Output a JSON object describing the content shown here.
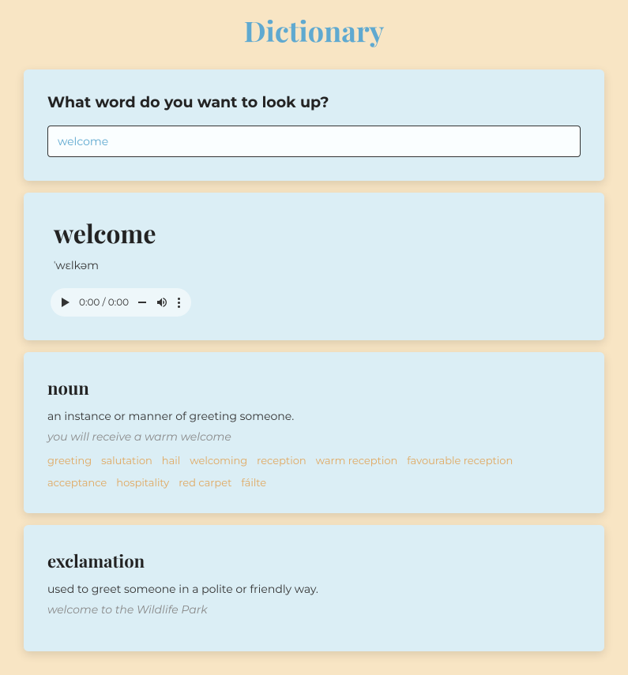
{
  "header": {
    "title": "Dictionary"
  },
  "search": {
    "label": "What word do you want to look up?",
    "value": "welcome"
  },
  "result": {
    "word": "welcome",
    "phonetic": "ˈwɛlkəm",
    "audio": {
      "current": "0:00",
      "duration": "0:00"
    }
  },
  "entries": [
    {
      "pos": "noun",
      "definition": "an instance or manner of greeting someone.",
      "example": "you will receive a warm welcome",
      "synonyms": [
        "greeting",
        "salutation",
        "hail",
        "welcoming",
        "reception",
        "warm reception",
        "favourable reception",
        "acceptance",
        "hospitality",
        "red carpet",
        "fáilte"
      ]
    },
    {
      "pos": "exclamation",
      "definition": "used to greet someone in a polite or friendly way.",
      "example": "welcome to the Wildlife Park",
      "synonyms": []
    }
  ]
}
